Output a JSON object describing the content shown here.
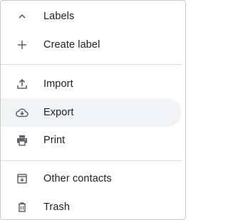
{
  "menu": {
    "labels_toggle": {
      "label": "Labels",
      "icon": "chevron-up-icon"
    },
    "create_label": {
      "label": "Create label",
      "icon": "plus-icon"
    },
    "import": {
      "label": "Import",
      "icon": "upload-icon"
    },
    "export": {
      "label": "Export",
      "icon": "cloud-download-icon",
      "selected": true
    },
    "print": {
      "label": "Print",
      "icon": "printer-icon"
    },
    "other_contacts": {
      "label": "Other contacts",
      "icon": "archive-icon"
    },
    "trash": {
      "label": "Trash",
      "icon": "trash-icon"
    }
  },
  "colors": {
    "text": "#202124",
    "icon": "#5f6368",
    "selected_bg": "#f1f3f4",
    "divider": "#dadce0"
  }
}
